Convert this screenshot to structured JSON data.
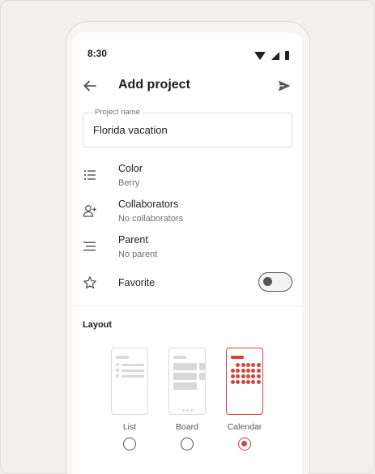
{
  "status_bar": {
    "time": "8:30"
  },
  "header": {
    "title": "Add project"
  },
  "project_name": {
    "label": "Project name",
    "value": "Florida vacation"
  },
  "settings": {
    "color": {
      "title": "Color",
      "value": "Berry"
    },
    "collaborators": {
      "title": "Collaborators",
      "value": "No collaborators"
    },
    "parent": {
      "title": "Parent",
      "value": "No parent"
    },
    "favorite": {
      "title": "Favorite",
      "enabled": false
    }
  },
  "layout": {
    "section_title": "Layout",
    "options": [
      {
        "label": "List",
        "selected": false
      },
      {
        "label": "Board",
        "selected": false
      },
      {
        "label": "Calendar",
        "selected": true
      }
    ]
  },
  "colors": {
    "accent": "#d1453b",
    "text": "#202020",
    "muted": "#707070"
  }
}
